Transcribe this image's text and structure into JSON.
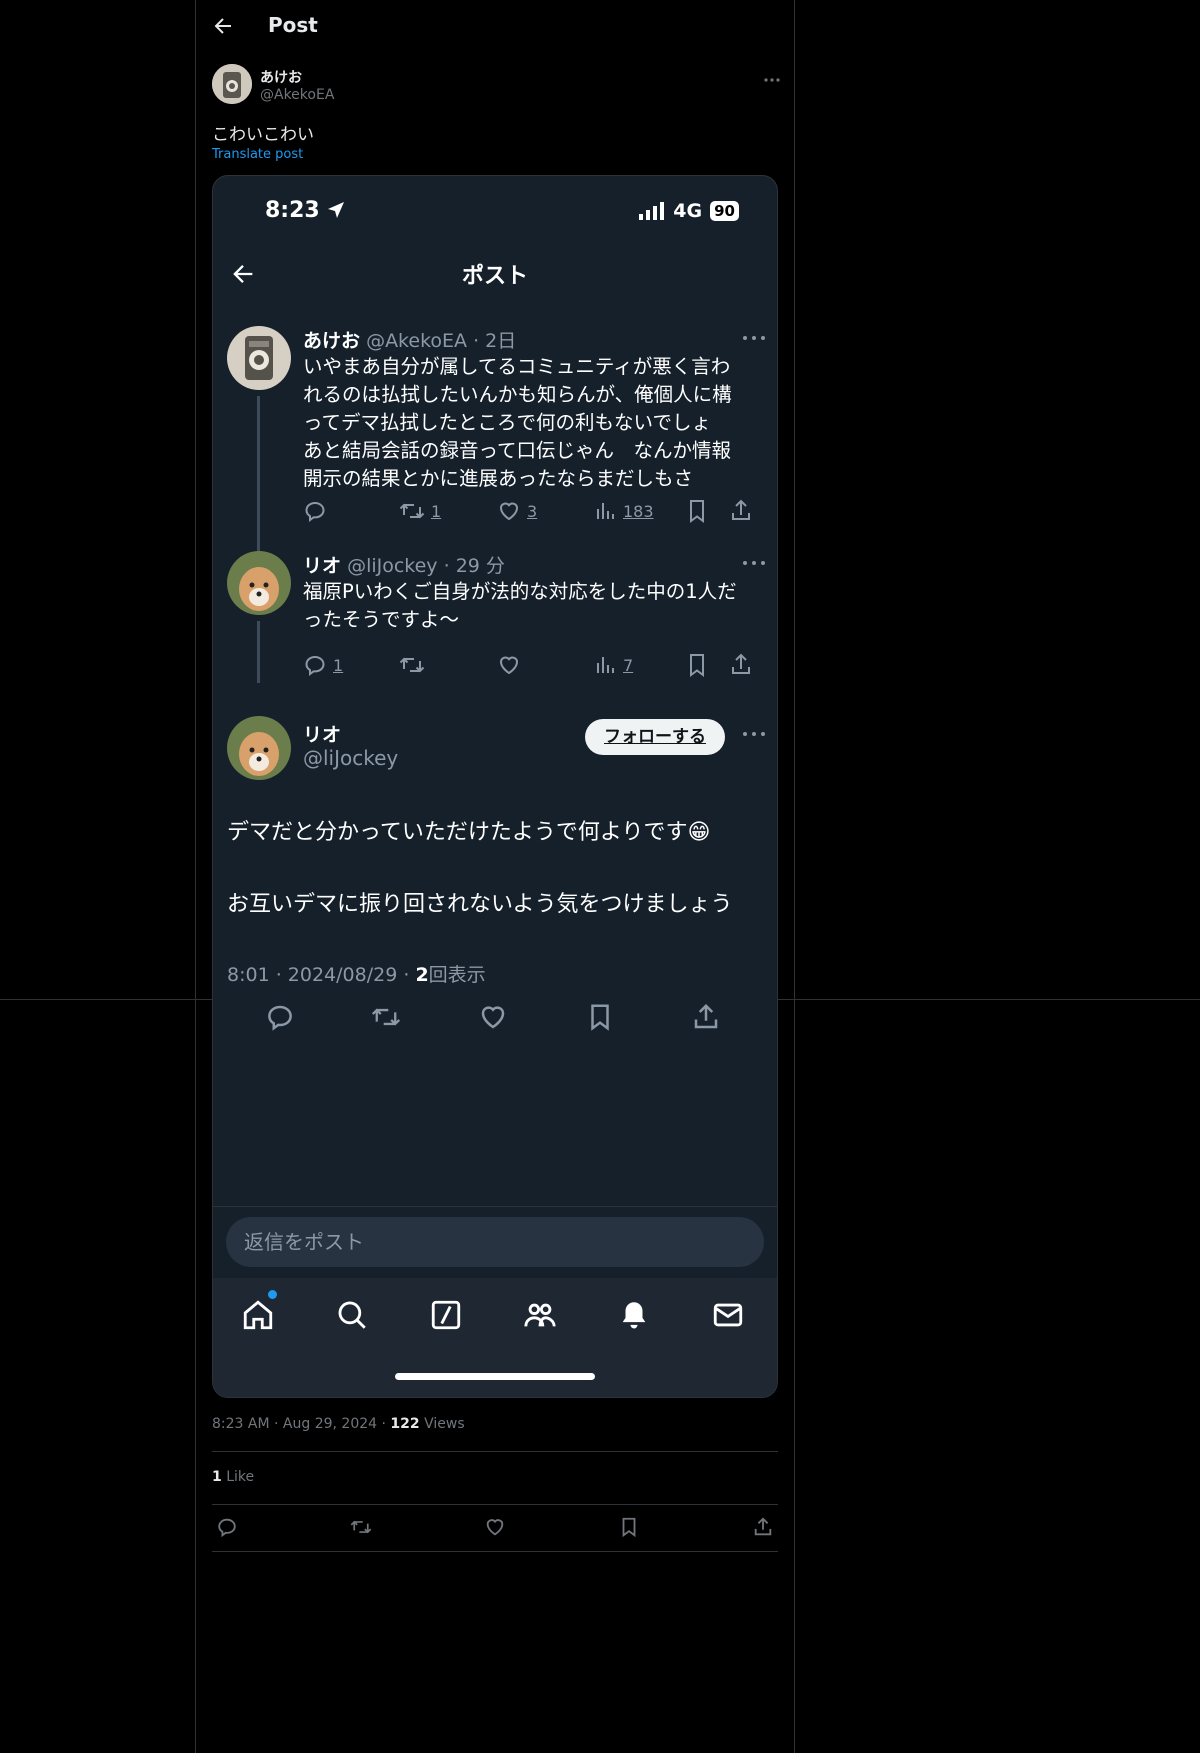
{
  "header": {
    "title": "Post"
  },
  "post": {
    "author_name": "あけお",
    "author_handle": "@AkekoEA",
    "text": "こわいこわい",
    "translate_label": "Translate post",
    "time": "8:23 AM",
    "date": "Aug 29, 2024",
    "views_count": "122",
    "views_label": "Views",
    "likes_count": "1",
    "likes_label": "Like"
  },
  "screenshot": {
    "status_time": "8:23",
    "network": "4G",
    "battery": "90",
    "header_title": "ポスト",
    "tweets": [
      {
        "name": "あけお",
        "handle": "@AkekoEA",
        "age": "2日",
        "lines": [
          "いやまあ自分が属してるコミュニティが悪く言わ",
          "れるのは払拭したいんかも知らんが、俺個人に構",
          "ってデマ払拭したところで何の利もないでしょ",
          "あと結局会話の録音って口伝じゃん　なんか情報",
          "開示の結果とかに進展あったならまだしもさ"
        ],
        "retweets": "1",
        "likes": "3",
        "views": "183"
      },
      {
        "name": "リオ",
        "handle": "@liJockey",
        "age": "29 分",
        "lines": [
          "福原Pいわくご自身が法的な対応をした中の1人だ",
          "ったそうですよ〜"
        ],
        "replies": "1",
        "views": "7"
      }
    ],
    "main": {
      "name": "リオ",
      "handle": "@liJockey",
      "follow_label": "フォローする",
      "line1": "デマだと分かっていただけたようで何よりです😁",
      "line2": "お互いデマに振り回されないよう気をつけましょう",
      "time": "8:01",
      "date": "2024/08/29",
      "views_count": "2",
      "views_label": "回表示"
    },
    "reply_placeholder": "返信をポスト"
  },
  "colors": {
    "accent": "#1d9bf0",
    "screenshot_bg": "#15202b",
    "page_bg": "#000000"
  }
}
